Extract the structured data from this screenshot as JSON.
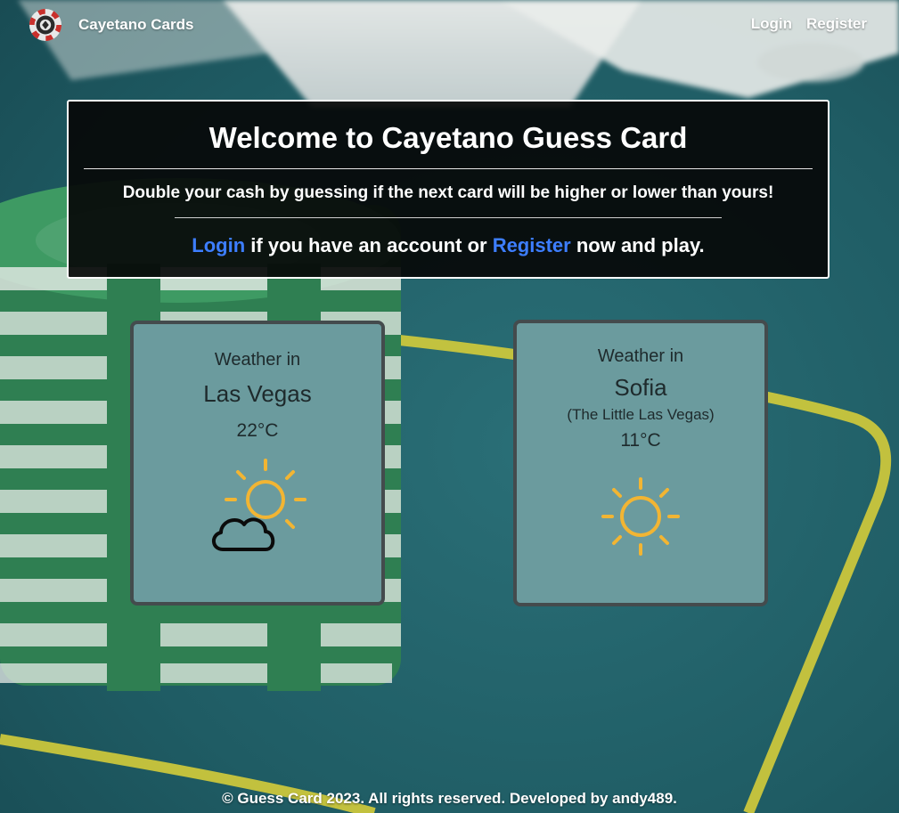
{
  "navbar": {
    "brand_name": "Cayetano Cards",
    "brand_icon": "poker-chip-icon",
    "login_label": "Login",
    "register_label": "Register"
  },
  "welcome": {
    "title": "Welcome to Cayetano Guess Card",
    "tagline": "Double your cash by guessing if the next card will be higher or lower than yours!",
    "login_link": "Login",
    "middle_text": " if you have an account or ",
    "register_link": "Register",
    "end_text": " now and play."
  },
  "weather": [
    {
      "heading": "Weather in",
      "city": "Las Vegas",
      "note": "",
      "temperature": "22°C",
      "icon": "partly-cloudy-icon"
    },
    {
      "heading": "Weather in",
      "city": "Sofia",
      "note": "(The Little Las Vegas)",
      "temperature": "11°C",
      "icon": "sun-icon"
    }
  ],
  "footer": {
    "text": "© Guess Card 2023. All rights reserved. Developed by andy489."
  },
  "colors": {
    "link_blue": "#3d7eff",
    "felt_teal": "#1f5a62",
    "card_teal": "#6b9b9e",
    "sun_yellow": "#f2b533",
    "chip_green": "#3e9a63",
    "table_line_yellow": "#d9cf3a"
  }
}
